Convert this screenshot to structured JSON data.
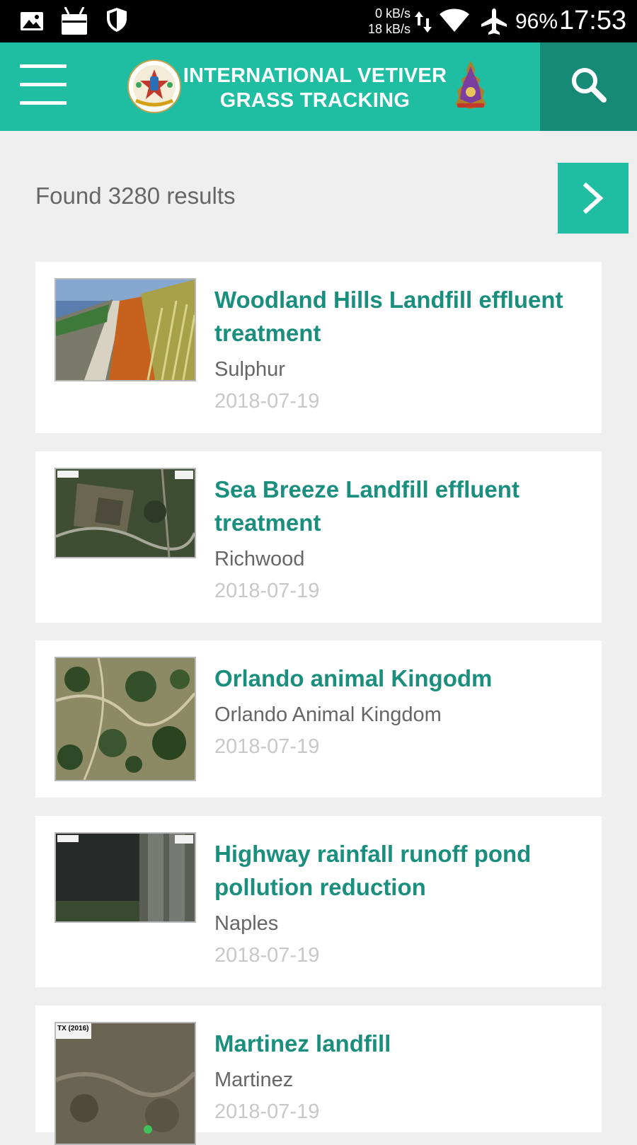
{
  "status_bar": {
    "icons": [
      "image-icon",
      "android-icon",
      "shield-icon",
      "data-transfer-icon",
      "wifi-icon",
      "airplane-mode-icon"
    ],
    "speed_up": "0 kB/s",
    "speed_down": "18 kB/s",
    "battery": "96%",
    "time": "17:53"
  },
  "header": {
    "title_line1": "INTERNATIONAL VETIVER",
    "title_line2": "GRASS TRACKING",
    "accent_color": "#1fbea3",
    "search_bg": "#168a77"
  },
  "results": {
    "found_text": "Found 3280 results"
  },
  "items": [
    {
      "title": "Woodland Hills Landfill effluent treatment",
      "location": "Sulphur",
      "date": "2018-07-19"
    },
    {
      "title": "Sea Breeze Landfill effluent treatment",
      "location": "Richwood",
      "date": "2018-07-19"
    },
    {
      "title": "Orlando animal Kingodm",
      "location": "Orlando Animal Kingdom",
      "date": "2018-07-19"
    },
    {
      "title": "Highway rainfall runoff pond pollution reduction",
      "location": "Naples",
      "date": "2018-07-19"
    },
    {
      "title": "Martinez landfill",
      "location": "Martinez",
      "date": "2018-07-19",
      "thumb_caption": "TX (2016)"
    }
  ]
}
